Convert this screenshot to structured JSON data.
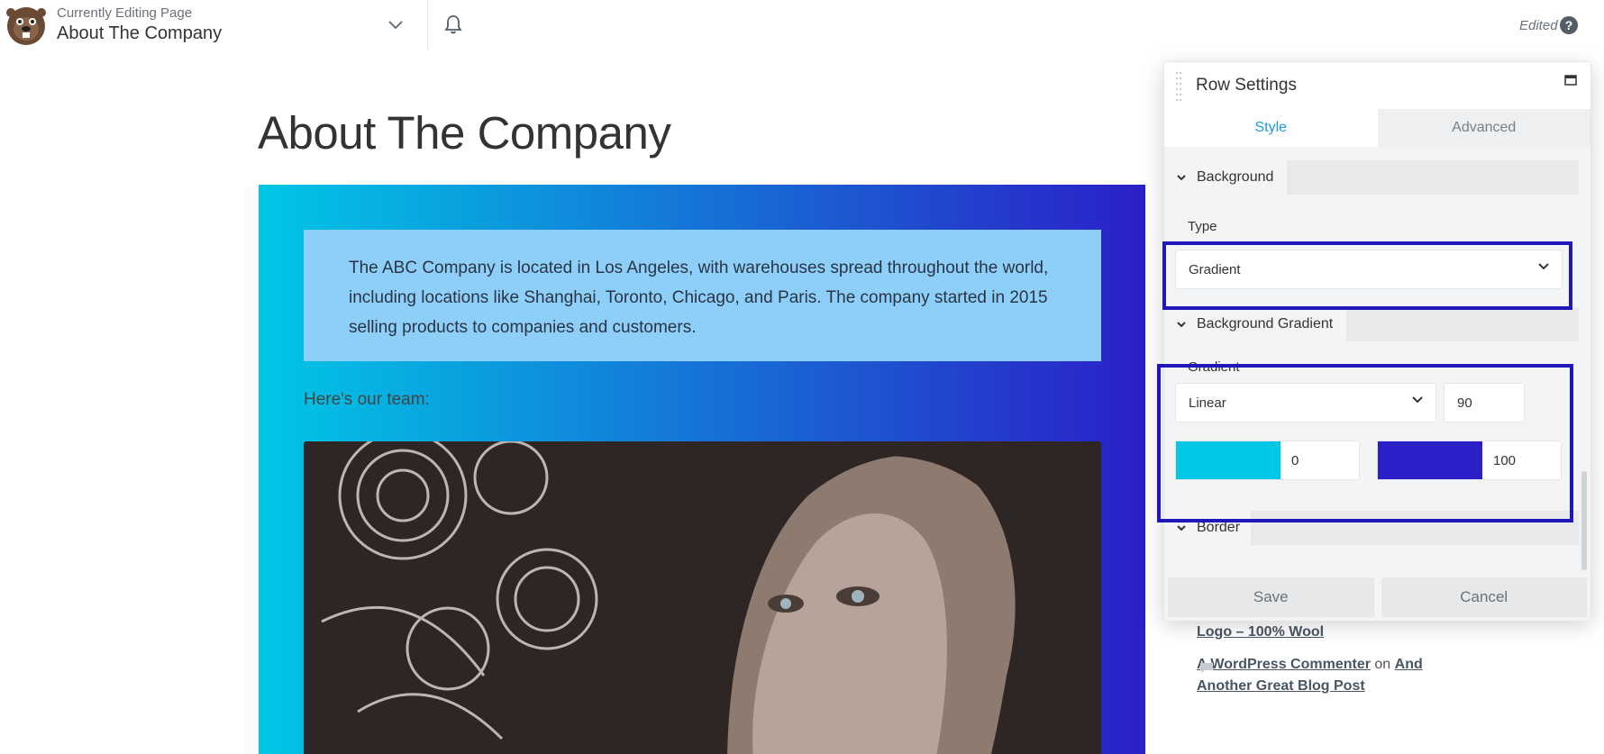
{
  "topbar": {
    "editing_label": "Currently Editing Page",
    "editing_title": "About The Company",
    "status": "Edited",
    "help": "?"
  },
  "page": {
    "title": "About The Company",
    "intro": "The ABC Company is located in Los Angeles, with warehouses spread throughout the world, including locations like Shanghai, Toronto, Chicago, and Paris. The company started in 2015 selling products to companies and customers.",
    "team_label": "Here's our team:",
    "row_gradient": {
      "start": "#00c7e6",
      "end": "#2b1fc7",
      "angle": 90
    }
  },
  "sidebar": {
    "recent_product": "Logo – 100% Wool",
    "comment_author": "A WordPress Commenter",
    "comment_on": "on",
    "comment_post": "And Another Great Blog Post"
  },
  "panel": {
    "title": "Row Settings",
    "tabs": [
      {
        "label": "Style",
        "active": true
      },
      {
        "label": "Advanced",
        "active": false
      }
    ],
    "sections": {
      "background": "Background",
      "background_gradient": "Background Gradient",
      "border": "Border"
    },
    "type_label": "Type",
    "type_value": "Gradient",
    "gradient_label": "Gradient",
    "gradient_type": "Linear",
    "gradient_angle": "90",
    "stop1": {
      "color": "#00c7e6",
      "position": "0"
    },
    "stop2": {
      "color": "#2b1fc7",
      "position": "100"
    },
    "save_label": "Save",
    "cancel_label": "Cancel",
    "highlight_color": "#1f17b8"
  }
}
